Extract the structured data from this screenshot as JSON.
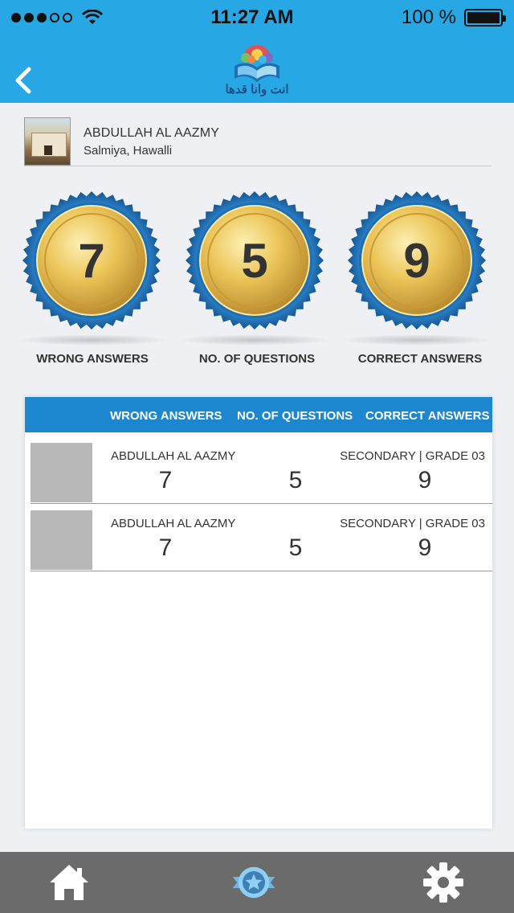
{
  "status_bar": {
    "time": "11:27 AM",
    "battery": "100 %"
  },
  "header": {
    "logo_text": "انت وانا قدها"
  },
  "profile": {
    "name": "ABDULLAH AL AAZMY",
    "location": "Salmiya, Hawalli"
  },
  "medals": [
    {
      "value": "7",
      "label": "WRONG ANSWERS"
    },
    {
      "value": "5",
      "label": "NO. OF QUESTIONS"
    },
    {
      "value": "9",
      "label": "CORRECT ANSWERS"
    }
  ],
  "table": {
    "headers": [
      "WRONG ANSWERS",
      "NO. OF QUESTIONS",
      "CORRECT ANSWERS"
    ],
    "rows": [
      {
        "name": "ABDULLAH AL AAZMY",
        "grade": "SECONDARY  |  GRADE 03",
        "wrong": "7",
        "questions": "5",
        "correct": "9"
      },
      {
        "name": "ABDULLAH AL AAZMY",
        "grade": "SECONDARY  |  GRADE 03",
        "wrong": "7",
        "questions": "5",
        "correct": "9"
      }
    ]
  },
  "colors": {
    "header_bg": "#27a7e3",
    "table_header_bg": "#1c86cf",
    "medal_rim": "#1a6fb8",
    "medal_gold": "#e8c25a",
    "nav_bg": "#6b6b6b"
  },
  "icons": {
    "back": "chevron-left-icon",
    "home": "home-icon",
    "badge": "star-badge-icon",
    "settings": "gear-icon"
  }
}
